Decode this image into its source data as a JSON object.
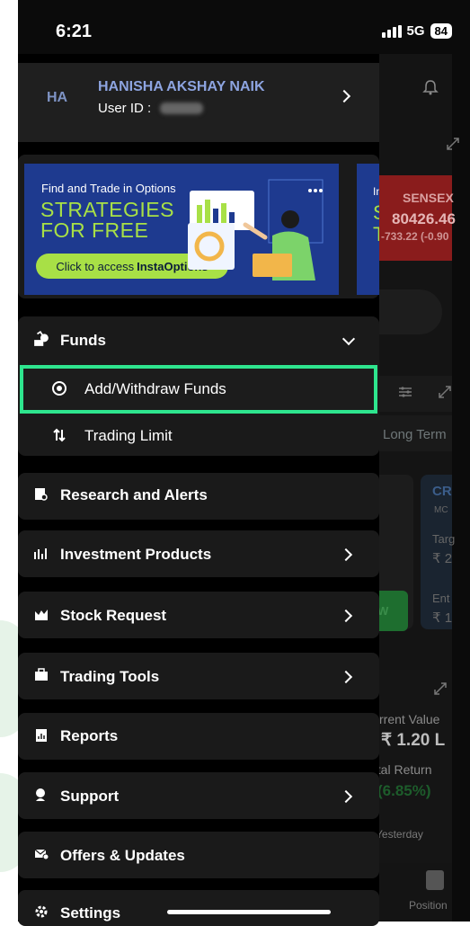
{
  "status_bar": {
    "time": "6:21",
    "network": "5G",
    "battery": "84"
  },
  "user": {
    "initials": "HA",
    "name": "HANISHA AKSHAY NAIK",
    "id_label": "User ID :"
  },
  "banner": {
    "small_text": "Find and Trade in Options",
    "headline_line1": "STRATEGIES",
    "headline_line2": "FOR FREE",
    "cta_prefix": "Click to access",
    "cta_brand": "InstaOptions",
    "next_banner_partial": [
      "In",
      "S",
      "T"
    ]
  },
  "menu": {
    "funds": {
      "label": "Funds",
      "icon": "moneybag-icon",
      "expanded": true,
      "sub_items": [
        {
          "label": "Add/Withdraw Funds",
          "icon": "rupee-coin-icon",
          "highlighted": true
        },
        {
          "label": "Trading Limit",
          "icon": "up-down-arrows-icon"
        }
      ]
    },
    "items": [
      {
        "label": "Research and Alerts",
        "icon": "research-icon",
        "has_chevron": false
      },
      {
        "label": "Investment Products",
        "icon": "chart-icon",
        "has_chevron": true
      },
      {
        "label": "Stock Request",
        "icon": "stock-request-icon",
        "has_chevron": true
      },
      {
        "label": "Trading Tools",
        "icon": "briefcase-icon",
        "has_chevron": true
      },
      {
        "label": "Reports",
        "icon": "report-icon",
        "has_chevron": false
      },
      {
        "label": "Support",
        "icon": "support-icon",
        "has_chevron": true
      },
      {
        "label": "Offers & Updates",
        "icon": "offers-icon",
        "has_chevron": false
      },
      {
        "label": "Settings",
        "icon": "gear-icon",
        "has_chevron": false
      }
    ]
  },
  "background": {
    "sensex_label": "SENSEX",
    "sensex_value": "80426.46",
    "sensex_change": "-733.22 (-0.90",
    "long_term": "Long Term",
    "card_cr": "CR",
    "card_mc": "MC",
    "targ": "Targ",
    "targ_val": "₹ 2",
    "ent": "Ent",
    "ent_val": "₹ 1",
    "green_btn": "W",
    "current_value": "rrent Value",
    "amount": "₹ 1.20 L",
    "total_return": "otal Return",
    "return_pct": "(6.85%)",
    "yesterday": "Yesterday",
    "position": "Position"
  },
  "colors": {
    "highlight": "#2ee58e",
    "user_name": "#8da4e0",
    "banner_bg": "#1e3a8f",
    "banner_accent": "#a8e046"
  }
}
